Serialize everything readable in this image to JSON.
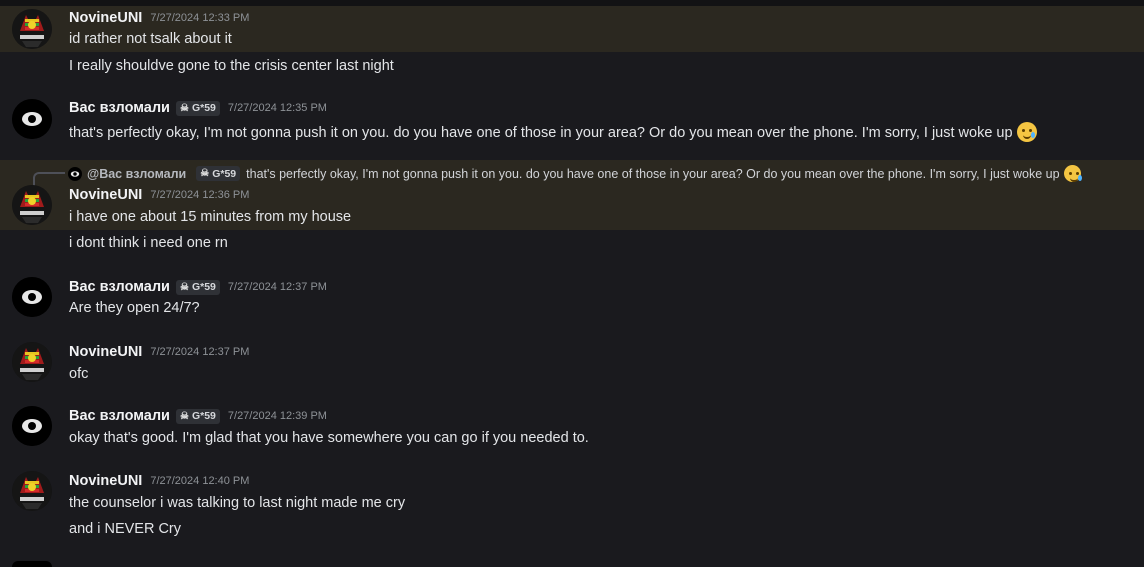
{
  "messages": [
    {
      "author": "NovineUNI",
      "timestamp": "7/27/2024 12:33 PM",
      "lines": [
        "id rather not tsalk about it",
        "I really shouldve gone to the crisis center last night"
      ]
    },
    {
      "author": "Вас взломали",
      "badge": "G*59",
      "timestamp": "7/27/2024 12:35 PM",
      "lines": [
        "that's perfectly okay, I'm not gonna push it on you. do you have one of those in your area? Or do you mean over the phone. I'm sorry, I just woke up"
      ]
    },
    {
      "reply_to": {
        "author": "@Вас взломали",
        "badge": "G*59",
        "text": "that's perfectly okay, I'm not gonna push it on you. do you have one of those in your area? Or do you mean over the phone. I'm sorry, I just woke up"
      },
      "author": "NovineUNI",
      "timestamp": "7/27/2024 12:36 PM",
      "lines": [
        "i have one about 15 minutes from my house",
        "i dont think i need one rn"
      ]
    },
    {
      "author": "Вас взломали",
      "badge": "G*59",
      "timestamp": "7/27/2024 12:37 PM",
      "lines": [
        "Are they open 24/7?"
      ]
    },
    {
      "author": "NovineUNI",
      "timestamp": "7/27/2024 12:37 PM",
      "lines": [
        "ofc"
      ]
    },
    {
      "author": "Вас взломали",
      "badge": "G*59",
      "timestamp": "7/27/2024 12:39 PM",
      "lines": [
        "okay that's good. I'm glad that you have somewhere you can go if you needed to."
      ]
    },
    {
      "author": "NovineUNI",
      "timestamp": "7/27/2024 12:40 PM",
      "lines": [
        "the counselor i was talking to last night made me cry",
        "and i NEVER Cry"
      ]
    }
  ],
  "colors": {
    "background": "#1a1a1e",
    "highlight": "#2b2820",
    "name": "#f2f3f5",
    "timestamp": "#8e9297"
  },
  "icons": {
    "badge": "skull-icon",
    "emoji": "crying-smile-emoji"
  }
}
